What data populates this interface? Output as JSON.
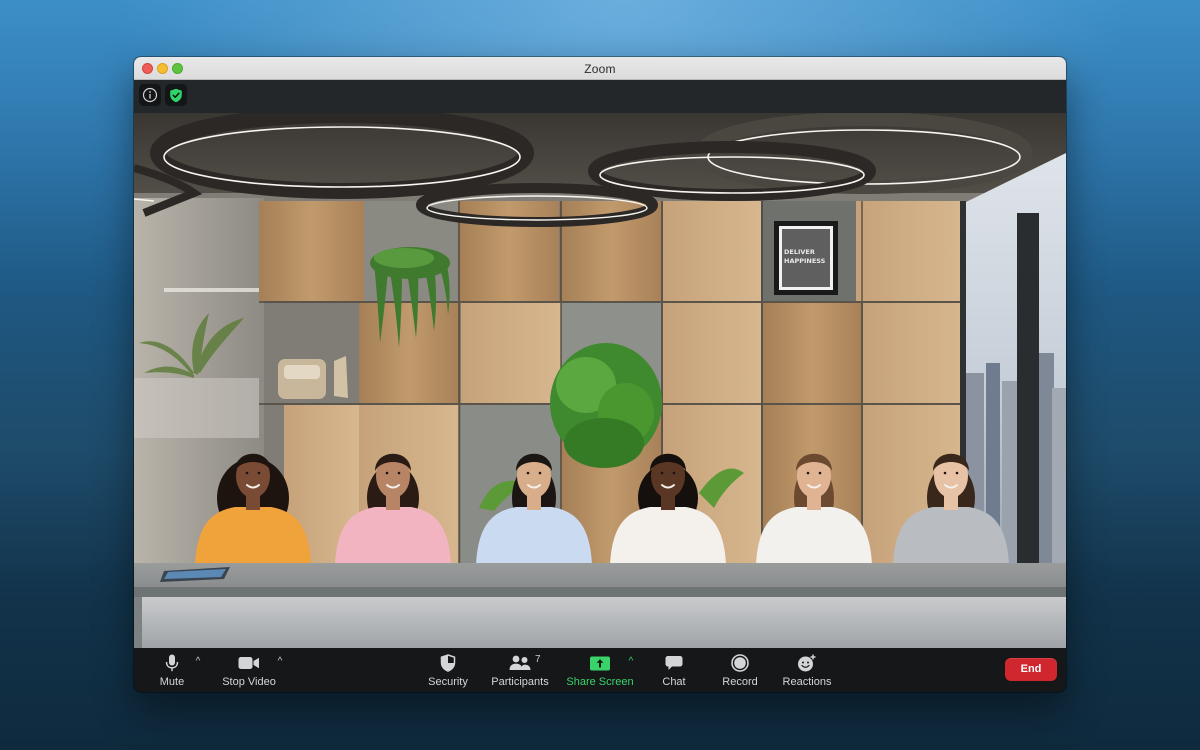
{
  "window": {
    "title": "Zoom",
    "traffic_lights": [
      "close",
      "minimize",
      "maximize"
    ]
  },
  "topbar": {
    "buttons": [
      {
        "name": "meeting-info",
        "icon": "info-icon"
      },
      {
        "name": "encryption-status",
        "icon": "shield-check-icon",
        "color": "#2fd56b"
      }
    ]
  },
  "scene": {
    "type": "immersive-view",
    "background": "office room with wood panel wall, ring ceiling lights, city window",
    "poster_text": [
      "DELIVER",
      "HAPPINESS"
    ],
    "participants_seated": 6,
    "participants": [
      {
        "position": 1,
        "shirt": "#f0a33a"
      },
      {
        "position": 2,
        "shirt": "#f3b4c1"
      },
      {
        "position": 3,
        "shirt": "#c9daf1"
      },
      {
        "position": 4,
        "shirt": "#f4f1ec"
      },
      {
        "position": 5,
        "shirt": "#f2f1ee"
      },
      {
        "position": 6,
        "shirt": "#b9bcc1"
      }
    ]
  },
  "toolbar": {
    "mute": {
      "label": "Mute",
      "icon": "microphone-icon"
    },
    "video": {
      "label": "Stop Video",
      "icon": "video-camera-icon"
    },
    "security": {
      "label": "Security",
      "icon": "shield-icon"
    },
    "participants": {
      "label": "Participants",
      "icon": "participants-icon",
      "count": "7"
    },
    "share": {
      "label": "Share Screen",
      "icon": "share-screen-icon",
      "color": "#3ad36a"
    },
    "chat": {
      "label": "Chat",
      "icon": "chat-bubble-icon"
    },
    "record": {
      "label": "Record",
      "icon": "record-icon"
    },
    "reactions": {
      "label": "Reactions",
      "icon": "emoji-add-icon"
    },
    "caret": "^",
    "end": {
      "label": "End",
      "color": "#d0262d"
    }
  }
}
